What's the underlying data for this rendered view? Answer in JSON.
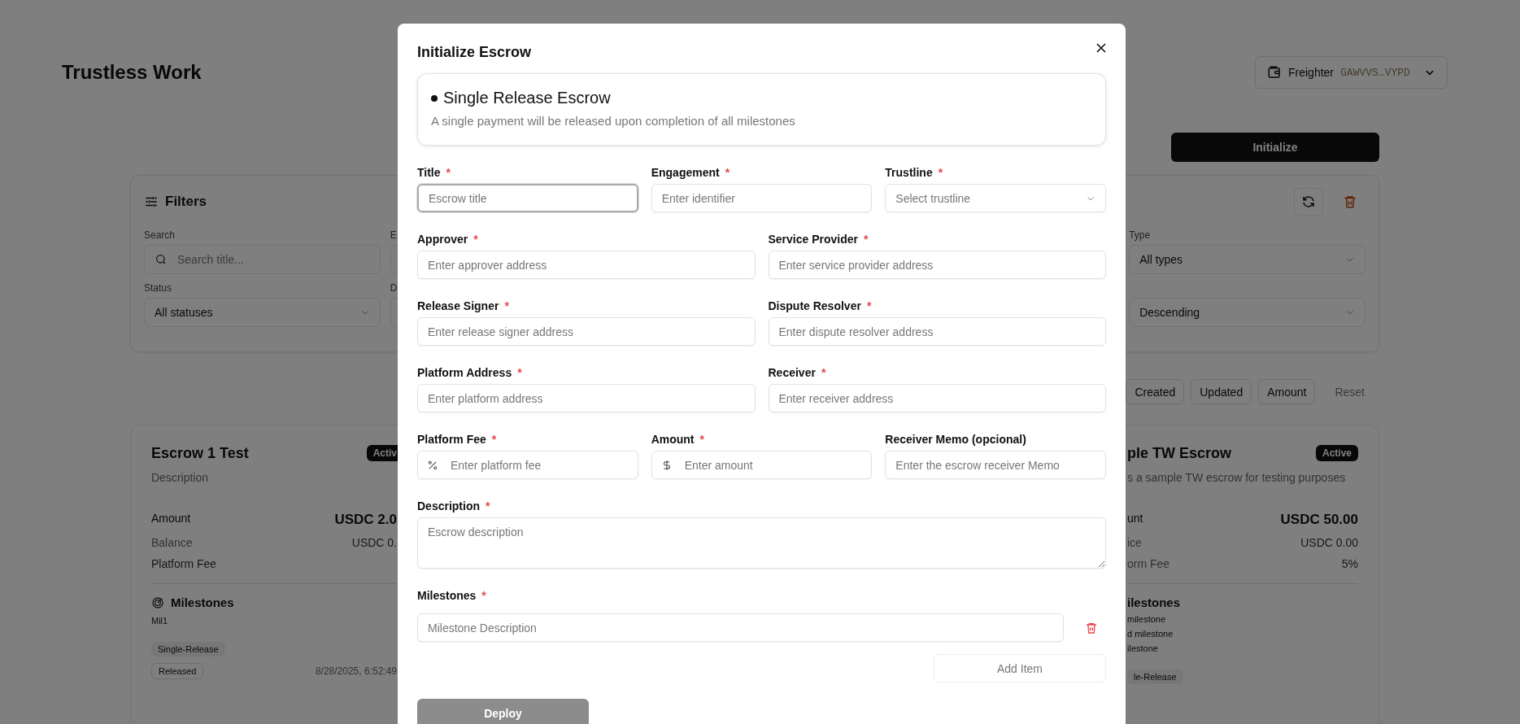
{
  "app": {
    "title": "Trustless Work"
  },
  "wallet": {
    "name": "Freighter",
    "address": "GAWVVS…VYPD"
  },
  "initialize_button": "Initialize",
  "filters": {
    "title": "Filters",
    "fields": [
      {
        "kind": "search",
        "label": "Search",
        "placeholder": "Search title..."
      },
      {
        "kind": "clipped",
        "label": "E"
      },
      {
        "kind": "select",
        "label": "Type",
        "value": "All types"
      },
      {
        "kind": "select",
        "label": "Status",
        "value": "All statuses"
      },
      {
        "kind": "clipped",
        "label": "D"
      },
      {
        "kind": "select",
        "value": "Descending"
      }
    ]
  },
  "sort_buttons": [
    "Created",
    "Updated",
    "Amount"
  ],
  "reset_button": "Reset",
  "cards": [
    {
      "title": "Escrow 1 Test",
      "status": "Activ",
      "description": "Description",
      "rows": [
        {
          "kind": "total",
          "label": "Amount",
          "value": "USDC 2.0"
        },
        {
          "kind": "plain",
          "label": "Balance",
          "value": "USDC 0."
        },
        {
          "kind": "plain",
          "label": "Platform Fee"
        }
      ],
      "milestones_icon": true,
      "milestones_title": "Milestones",
      "milestones": [
        "Mil1"
      ],
      "tags": [
        "Single-Release",
        "Released"
      ],
      "date": "8/28/2025, 6:52:49"
    },
    {
      "title": "ple TW Escrow",
      "status": "Active",
      "description": "s a sample TW escrow for testing purposes",
      "rows": [
        {
          "kind": "total",
          "label": "unt",
          "value": "USDC 50.00"
        },
        {
          "kind": "plain",
          "label": "ice",
          "value": "USDC 0.00"
        },
        {
          "kind": "plain",
          "label": "orm Fee",
          "value": "5%"
        }
      ],
      "milestones_icon": false,
      "milestones_title": "ilestones",
      "milestones": [
        "milestone",
        "d milestone",
        "ilestone"
      ],
      "tags": [
        "le-Release"
      ]
    }
  ],
  "modal": {
    "title": "Initialize Escrow",
    "type_card": {
      "title": "Single Release Escrow",
      "description": "A single payment will be released upon completion of all milestones"
    },
    "required_mark": "*",
    "rows": [
      {
        "fields": [
          {
            "kind": "text",
            "label": "Title",
            "placeholder": "Escrow title",
            "required": true,
            "focused": true
          },
          {
            "kind": "text",
            "label": "Engagement",
            "placeholder": "Enter identifier",
            "required": true,
            "focused": false
          },
          {
            "kind": "select",
            "label": "Trustline",
            "placeholder": "Select trustline",
            "required": true,
            "focused": false
          }
        ]
      },
      {
        "fields": [
          {
            "kind": "text",
            "label": "Approver",
            "placeholder": "Enter approver address",
            "required": true,
            "focused": false
          },
          {
            "kind": "text",
            "label": "Service Provider",
            "placeholder": "Enter service provider address",
            "required": true,
            "focused": false
          }
        ]
      },
      {
        "fields": [
          {
            "kind": "text",
            "label": "Release Signer",
            "placeholder": "Enter release signer address",
            "required": true,
            "focused": false
          },
          {
            "kind": "text",
            "label": "Dispute Resolver",
            "placeholder": "Enter dispute resolver address",
            "required": true,
            "focused": false
          }
        ]
      },
      {
        "fields": [
          {
            "kind": "text",
            "label": "Platform Address",
            "placeholder": "Enter platform address",
            "required": true,
            "focused": false
          },
          {
            "kind": "text",
            "label": "Receiver",
            "placeholder": "Enter receiver address",
            "required": true,
            "focused": false
          }
        ]
      },
      {
        "fields": [
          {
            "kind": "percent",
            "label": "Platform Fee",
            "placeholder": "Enter platform fee",
            "required": true,
            "focused": false
          },
          {
            "kind": "currency",
            "label": "Amount",
            "placeholder": "Enter amount",
            "required": true,
            "focused": false
          },
          {
            "kind": "text",
            "label": "Receiver Memo (opcional)",
            "placeholder": "Enter the escrow receiver Memo",
            "required": false,
            "focused": false
          }
        ]
      },
      {
        "fields": [
          {
            "kind": "textarea",
            "label": "Description",
            "placeholder": "Escrow description",
            "required": true,
            "focused": false
          }
        ]
      }
    ],
    "milestones": {
      "label": "Milestones",
      "required": true,
      "items": [
        {
          "placeholder": "Milestone Description"
        }
      ],
      "add_button": "Add Item"
    },
    "deploy_button": {
      "label": "Deploy",
      "disabled": true
    }
  }
}
